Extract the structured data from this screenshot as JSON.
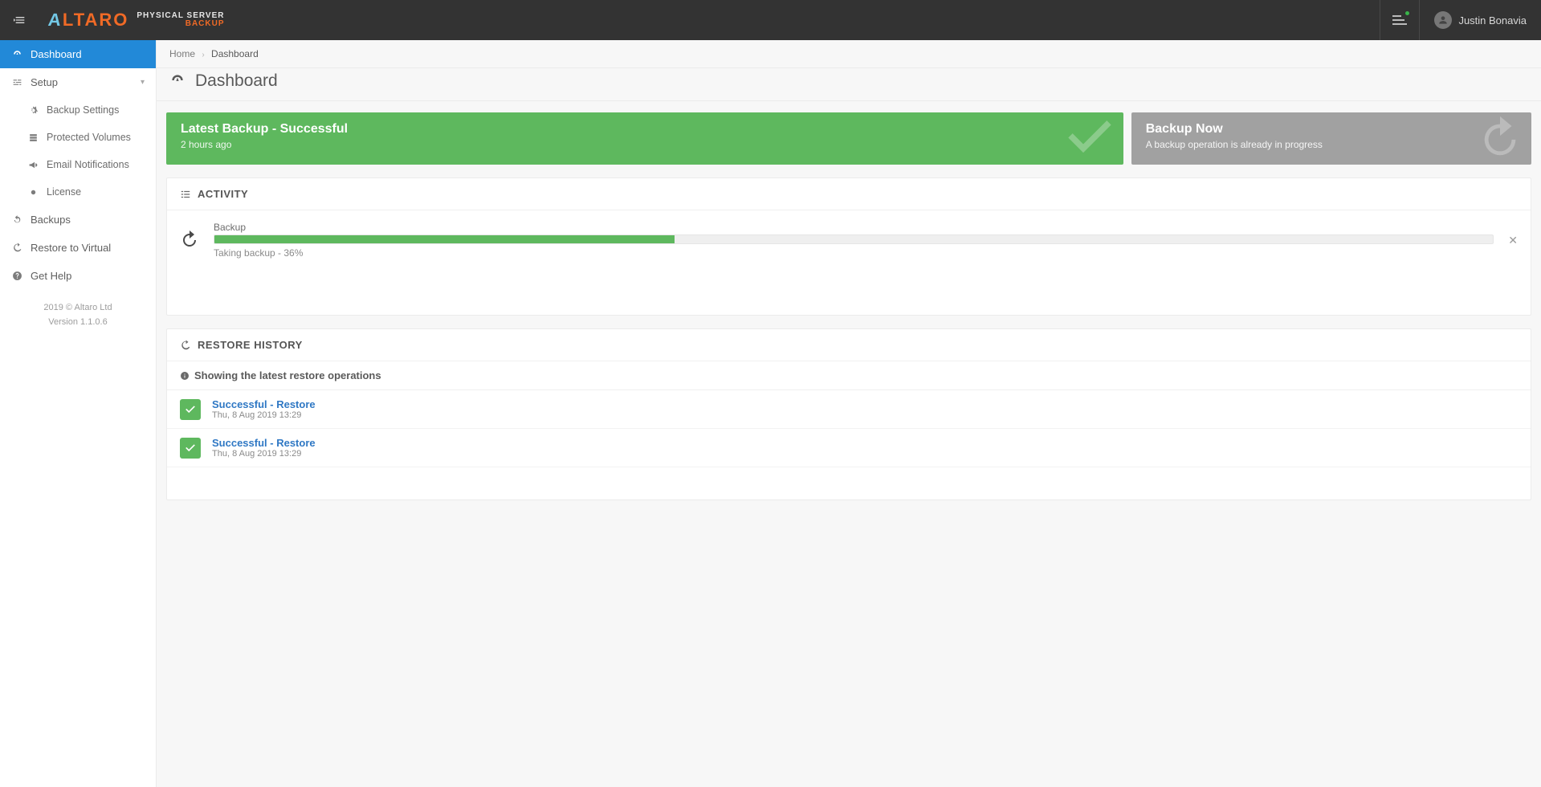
{
  "brand": {
    "logo_main": "ALTARO",
    "sub_line1": "PHYSICAL SERVER",
    "sub_line2": "BACKUP"
  },
  "user": {
    "name": "Justin Bonavia"
  },
  "sidebar": {
    "items": [
      {
        "label": "Dashboard"
      },
      {
        "label": "Setup"
      },
      {
        "label": "Backup Settings"
      },
      {
        "label": "Protected Volumes"
      },
      {
        "label": "Email Notifications"
      },
      {
        "label": "License"
      },
      {
        "label": "Backups"
      },
      {
        "label": "Restore to Virtual"
      },
      {
        "label": "Get Help"
      }
    ],
    "footer_copyright": "2019 © Altaro Ltd",
    "footer_version": "Version 1.1.0.6"
  },
  "breadcrumb": {
    "home": "Home",
    "current": "Dashboard"
  },
  "page_title": "Dashboard",
  "tiles": {
    "latest_backup": {
      "title": "Latest Backup - Successful",
      "sub": "2 hours ago"
    },
    "backup_now": {
      "title": "Backup Now",
      "sub": "A backup operation is already in progress"
    }
  },
  "activity": {
    "header": "ACTIVITY",
    "title": "Backup",
    "status": "Taking backup - 36%",
    "percent": 36
  },
  "restore_history": {
    "header": "RESTORE HISTORY",
    "info": "Showing the latest restore operations",
    "items": [
      {
        "title": "Successful - Restore",
        "time": "Thu, 8 Aug 2019 13:29"
      },
      {
        "title": "Successful - Restore",
        "time": "Thu, 8 Aug 2019 13:29"
      }
    ]
  }
}
